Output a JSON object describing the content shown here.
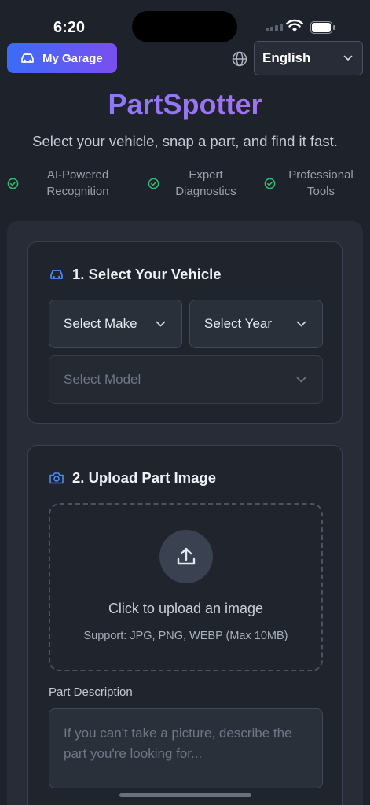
{
  "status": {
    "time": "6:20"
  },
  "header": {
    "garage_label": "My Garage",
    "language": "English"
  },
  "hero": {
    "brand": "PartSpotter",
    "tagline": "Select your vehicle, snap a part, and find it fast.",
    "features": [
      {
        "line1": "AI-Powered",
        "line2": "Recognition"
      },
      {
        "line1": "Expert",
        "line2": "Diagnostics"
      },
      {
        "line1": "Professional",
        "line2": "Tools"
      }
    ]
  },
  "vehicle": {
    "title": "1. Select Your Vehicle",
    "make": "Select Make",
    "year": "Select Year",
    "model": "Select Model"
  },
  "upload": {
    "title": "2. Upload Part Image",
    "cta": "Click to upload an image",
    "support": "Support: JPG, PNG, WEBP (Max 10MB)",
    "desc_label": "Part Description",
    "desc_placeholder": "If you can't take a picture, describe the part you're looking for..."
  },
  "colors": {
    "accent_start": "#3b6cf6",
    "accent_end": "#7a4ff0",
    "check_green": "#2fbf71",
    "icon_blue": "#4a8cf7"
  }
}
